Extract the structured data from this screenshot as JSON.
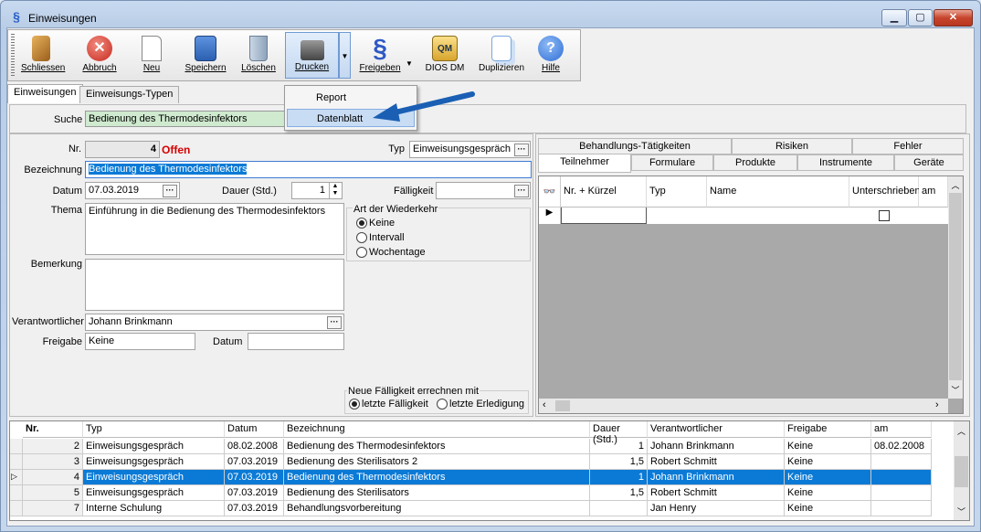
{
  "window": {
    "title": "Einweisungen",
    "app_icon": "§"
  },
  "toolbar": {
    "items": [
      {
        "label": "Schliessen",
        "icon": "door-exit-icon",
        "color": "#c98a2c"
      },
      {
        "label": "Abbruch",
        "icon": "cancel-icon",
        "color": "#d43a2e"
      },
      {
        "label": "Neu",
        "icon": "new-page-icon",
        "color": "#ffffff"
      },
      {
        "label": "Speichern",
        "icon": "save-icon",
        "color": "#2b6fcf"
      },
      {
        "label": "Löschen",
        "icon": "trash-icon",
        "color": "#8aa0b8"
      },
      {
        "label": "Drucken",
        "icon": "printer-icon",
        "color": "#555555"
      },
      {
        "label": "Freigeben",
        "icon": "paragraph-icon",
        "color": "#2f59c4"
      },
      {
        "label": "DIOS DM",
        "icon": "qm-pdf-icon",
        "color": "#d8a52e"
      },
      {
        "label": "Duplizieren",
        "icon": "duplicate-icon",
        "color": "#7aa7e0"
      },
      {
        "label": "Hilfe",
        "icon": "help-icon",
        "color": "#2f6fd6"
      }
    ],
    "dropdown_arrow": "▼"
  },
  "tabs": [
    {
      "label": "Einweisungen"
    },
    {
      "label": "Einweisungs-Typen"
    }
  ],
  "search": {
    "label": "Suche",
    "value": "Bedienung des Thermodesinfektors"
  },
  "dropdown_menu": {
    "items": [
      "Report",
      "Datenblatt"
    ],
    "highlighted": "Datenblatt"
  },
  "form": {
    "nr_label": "Nr.",
    "nr_value": "4",
    "status": "Offen",
    "typ_label": "Typ",
    "typ_value": "Einweisungsgespräch",
    "bezeichnung_label": "Bezeichnung",
    "bezeichnung_value": "Bedienung des Thermodesinfektors",
    "datum_label": "Datum",
    "datum_value": "07.03.2019",
    "dauer_label": "Dauer (Std.)",
    "dauer_value": "1",
    "faelligkeit_label": "Fälligkeit",
    "faelligkeit_value": "",
    "thema_label": "Thema",
    "thema_value": "Einführung in die Bedienung des Thermodesinfektors",
    "bemerkung_label": "Bemerkung",
    "bemerkung_value": "",
    "verantwortlicher_label": "Verantwortlicher",
    "verantwortlicher_value": "Johann Brinkmann",
    "freigabe_label": "Freigabe",
    "freigabe_value": "Keine",
    "freigabe_datum_label": "Datum",
    "freigabe_datum_value": "",
    "wiederkehr_title": "Art der Wiederkehr",
    "wiederkehr_options": [
      "Keine",
      "Intervall",
      "Wochentage"
    ],
    "wiederkehr_selected": "Keine",
    "faelligkeit_group_title": "Neue Fälligkeit errechnen mit",
    "faelligkeit_options": [
      "letzte Fälligkeit",
      "letzte Erledigung"
    ],
    "faelligkeit_selected": "letzte Fälligkeit"
  },
  "right_tabs": {
    "row1": [
      "Behandlungs-Tätigkeiten",
      "Risiken",
      "Fehler"
    ],
    "row2": [
      "Teilnehmer",
      "Formulare",
      "Produkte",
      "Instrumente",
      "Geräte"
    ],
    "active": "Teilnehmer"
  },
  "teilnehmer_grid": {
    "columns": [
      "Nr. + Kürzel",
      "Typ",
      "Name",
      "Unterschrieben",
      "am"
    ]
  },
  "main_table": {
    "columns": [
      "Nr.",
      "Typ",
      "Datum",
      "Bezeichnung",
      "Dauer (Std.)",
      "Verantwortlicher",
      "Freigabe",
      "am"
    ],
    "rows": [
      [
        "2",
        "Einweisungsgespräch",
        "08.02.2008",
        "Bedienung des Thermodesinfektors",
        "1",
        "Johann Brinkmann",
        "Keine",
        "08.02.2008"
      ],
      [
        "3",
        "Einweisungsgespräch",
        "07.03.2019",
        "Bedienung des Sterilisators 2",
        "1,5",
        "Robert Schmitt",
        "Keine",
        ""
      ],
      [
        "4",
        "Einweisungsgespräch",
        "07.03.2019",
        "Bedienung des Thermodesinfektors",
        "1",
        "Johann Brinkmann",
        "Keine",
        ""
      ],
      [
        "5",
        "Einweisungsgespräch",
        "07.03.2019",
        "Bedienung des Sterilisators",
        "1,5",
        "Robert Schmitt",
        "Keine",
        ""
      ],
      [
        "7",
        "Interne Schulung",
        "07.03.2019",
        "Behandlungsvorbereitung",
        "",
        "Jan Henry",
        "Keine",
        ""
      ]
    ],
    "selected_row": 2
  },
  "colors": {
    "accent": "#0a7ad6",
    "status_offen": "#d40000",
    "search_bg": "#cfeacf",
    "arrow": "#1a5fb4"
  }
}
